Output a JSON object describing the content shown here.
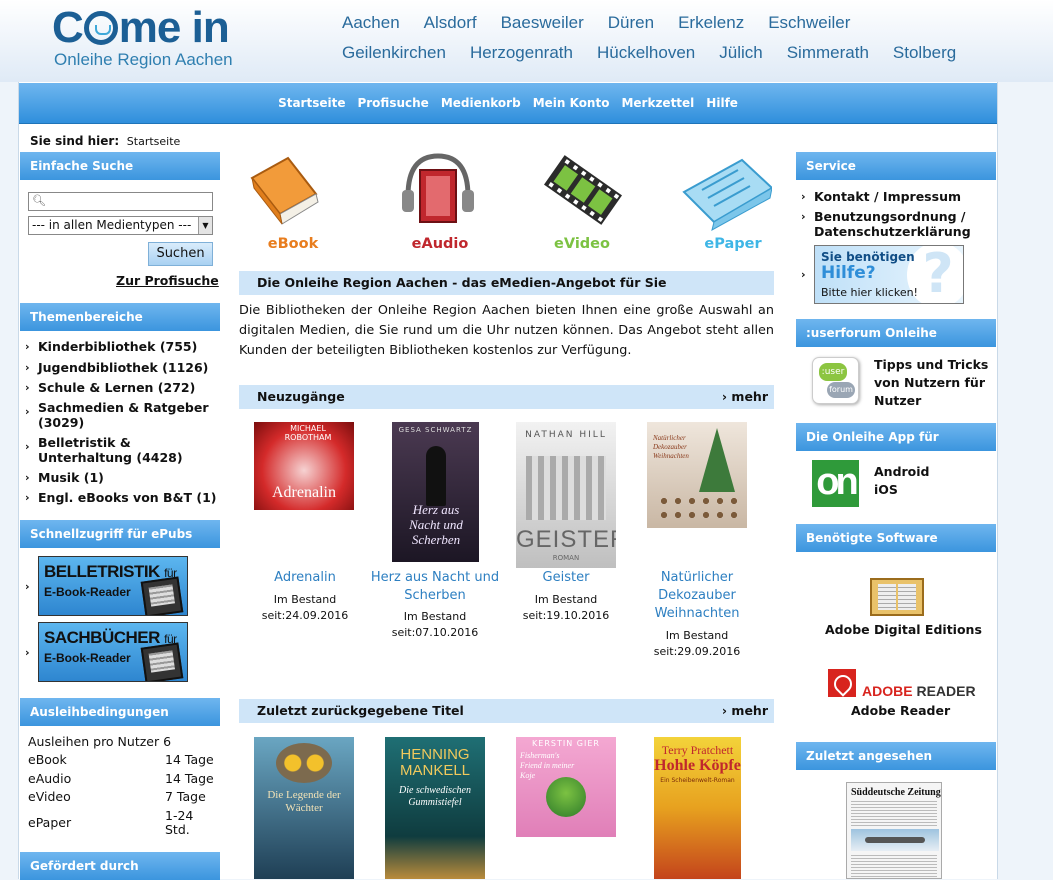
{
  "logo": {
    "text_start": "C",
    "text_end": "me in",
    "sub": "Onleihe Region Aachen"
  },
  "cities_row1": [
    "Aachen",
    "Alsdorf",
    "Baesweiler",
    "Düren",
    "Erkelenz",
    "Eschweiler"
  ],
  "cities_row2": [
    "Geilenkirchen",
    "Herzogenrath",
    "Hückelhoven",
    "Jülich",
    "Simmerath",
    "Stolberg"
  ],
  "nav": [
    "Startseite",
    "Profisuche",
    "Medienkorb",
    "Mein Konto",
    "Merkzettel",
    "Hilfe"
  ],
  "breadcrumb": {
    "label": "Sie sind hier:",
    "current": "Startseite"
  },
  "simple_search": {
    "title": "Einfache Suche",
    "input_value": "",
    "select_value": "--- in allen Medientypen ---",
    "button": "Suchen",
    "pro_link": "Zur Profisuche"
  },
  "topics": {
    "title": "Themenbereiche",
    "items": [
      "Kinderbibliothek (755)",
      "Jugendbibliothek (1126)",
      "Schule & Lernen (272)",
      "Sachmedien & Ratgeber (3029)",
      "Belletristik & Unterhaltung (4428)",
      "Musik (1)",
      "Engl. eBooks von B&T (1)"
    ]
  },
  "quick_access": {
    "title": "Schnellzugriff für ePubs",
    "banners": [
      {
        "big": "BELLETRISTIK",
        "small": "für",
        "sub": "E-Book-Reader"
      },
      {
        "big": "SACHBÜCHER",
        "small": "für",
        "sub": "E-Book-Reader"
      }
    ]
  },
  "loan": {
    "title": "Ausleihbedingungen",
    "per_user": "Ausleihen pro Nutzer 6",
    "rows": [
      {
        "k": "eBook",
        "v": "14 Tage"
      },
      {
        "k": "eAudio",
        "v": "14 Tage"
      },
      {
        "k": "eVideo",
        "v": "7 Tage"
      },
      {
        "k": "ePaper",
        "v": "1-24 Std."
      }
    ]
  },
  "funded": {
    "title": "Gefördert durch"
  },
  "media": [
    "eBook",
    "eAudio",
    "eVideo",
    "ePaper"
  ],
  "colors": {
    "ebook": "#e87d1e",
    "eaudio": "#c0272d",
    "evideo": "#7cc242",
    "epaper": "#3fb6e6",
    "accent": "#3b95de",
    "link": "#2d7fc1"
  },
  "intro": {
    "title": "Die Onleihe Region Aachen - das eMedien-Angebot für Sie",
    "text": "Die Bibliotheken der Onleihe Region Aachen bieten Ihnen eine große Auswahl an digitalen Medien, die Sie rund um die Uhr nutzen können. Das Angebot steht allen Kunden der beteiligten Bibliotheken kostenlos zur Verfügung."
  },
  "new_items": {
    "title": "Neuzugänge",
    "more": "mehr",
    "books": [
      {
        "title": "Adrenalin",
        "status": "Im Bestand seit:24.09.2016",
        "cover_author": "MICHAEL ROBOTHAM",
        "cover_title": "Adrenalin"
      },
      {
        "title": "Herz aus Nacht und Scherben",
        "status": "Im Bestand seit:07.10.2016",
        "cover_author": "GESA SCHWARTZ",
        "cover_title": "Herz aus Nacht und Scherben"
      },
      {
        "title": "Geister",
        "status": "Im Bestand seit:19.10.2016",
        "cover_author": "NATHAN HILL",
        "cover_title": "GEISTER",
        "cover_sub": "ROMAN"
      },
      {
        "title": "Natürlicher Dekozauber Weihnachten",
        "status": "Im Bestand seit:29.09.2016",
        "cover_title": "Natürlicher Dekozauber Weihnachten"
      }
    ]
  },
  "returned": {
    "title": "Zuletzt zurückgegebene Titel",
    "more": "mehr",
    "covers": [
      {
        "title": "Die Legende der Wächter"
      },
      {
        "author": "HENNING MANKELL",
        "title": "Die schwedischen Gummistiefel"
      },
      {
        "author": "KERSTIN GIER",
        "title": "Fisherman's Friend in meiner Koje"
      },
      {
        "author": "Terry Pratchett",
        "title": "Hohle Köpfe",
        "sub": "Ein Scheibenwelt-Roman"
      }
    ]
  },
  "service": {
    "title": "Service",
    "links": [
      "Kontakt / Impressum",
      "Benutzungsordnung / Datenschutzerklärung"
    ],
    "help_banner": {
      "l1": "Sie benötigen",
      "l2": "Hilfe?",
      "l3": "Bitte hier klicken!"
    }
  },
  "userforum": {
    "title": ":userforum Onleihe",
    "text": "Tipps und Tricks von Nutzern für Nutzer",
    "icon_top": ":user",
    "icon_bottom": "forum"
  },
  "app": {
    "title": "Die Onleihe App für",
    "items": [
      "Android",
      "iOS"
    ],
    "icon_text": "on"
  },
  "software": {
    "title": "Benötigte Software",
    "items": [
      "Adobe Digital Editions",
      "Adobe Reader"
    ],
    "reader_logo_a": "ADOBE",
    "reader_logo_b": " READER"
  },
  "recent": {
    "title": "Zuletzt angesehen",
    "paper": "Süddeutsche Zeitung"
  }
}
